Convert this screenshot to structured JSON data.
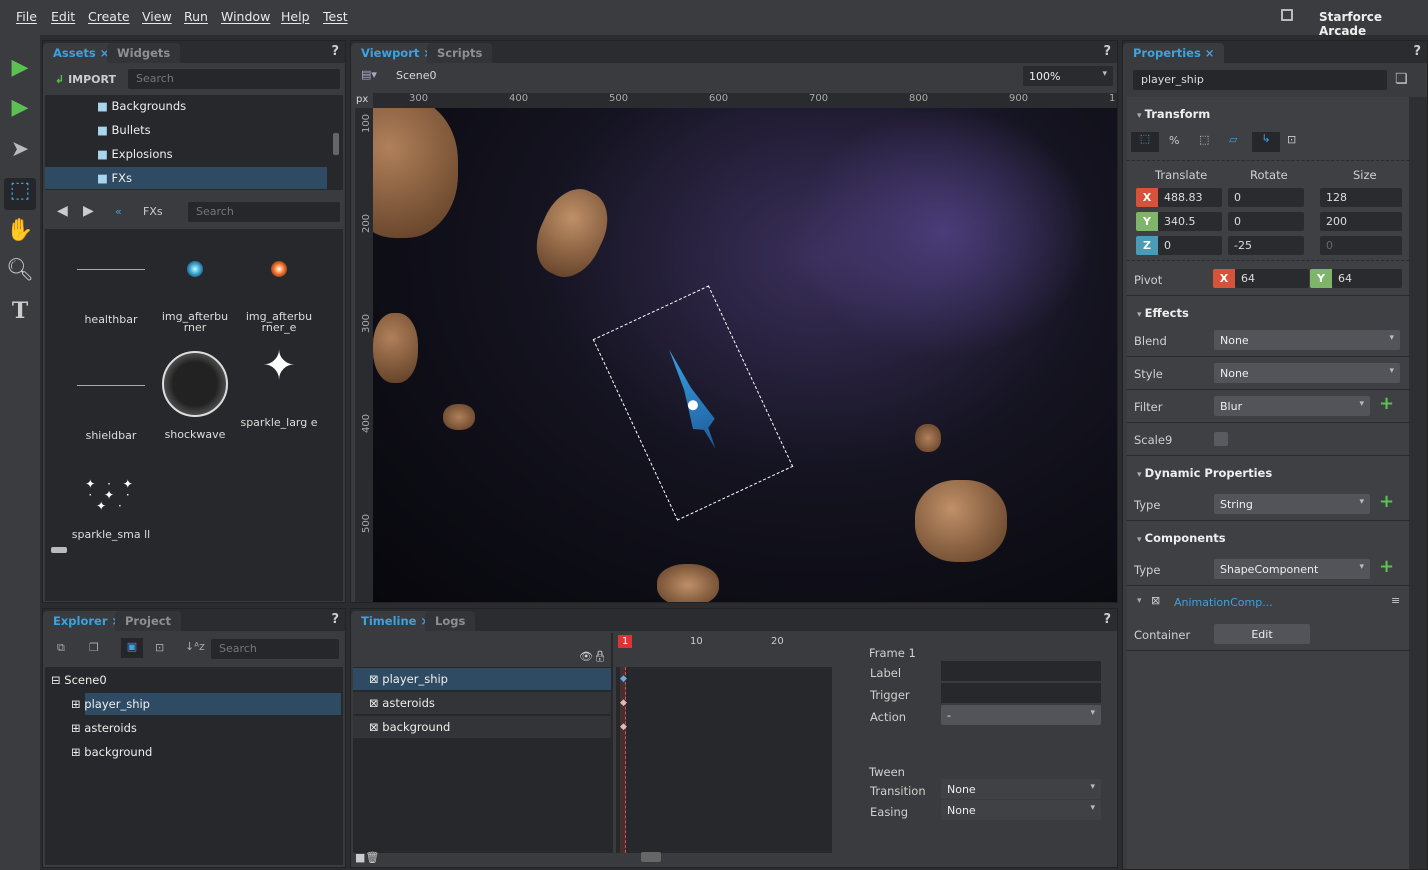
{
  "menu": [
    "File",
    "Edit",
    "Create",
    "View",
    "Run",
    "Window",
    "Help",
    "Test"
  ],
  "app_title": "Starforce Arcade",
  "assets": {
    "tabs": [
      "Assets",
      "Widgets"
    ],
    "import_label": "IMPORT",
    "search_placeholder": "Search",
    "folders": [
      "Backgrounds",
      "Bullets",
      "Explosions",
      "FXs"
    ],
    "selected_folder": "FXs",
    "breadcrumb": "FXs",
    "search2_placeholder": "Search",
    "items": [
      "healthbar",
      "img_afterbu rner",
      "img_afterbu rner_e",
      "shieldbar",
      "shockwave",
      "sparkle_larg e",
      "sparkle_sma ll"
    ]
  },
  "viewport": {
    "tabs": [
      "Viewport",
      "Scripts"
    ],
    "scene": "Scene0",
    "zoom": "100%",
    "unit": "px",
    "ruler_x": [
      "300",
      "400",
      "500",
      "600",
      "700",
      "800",
      "900",
      "1"
    ],
    "ruler_y": [
      "100",
      "200",
      "300",
      "400",
      "500"
    ]
  },
  "explorer": {
    "tabs": [
      "Explorer",
      "Project"
    ],
    "search_placeholder": "Search",
    "root": "Scene0",
    "nodes": [
      "player_ship",
      "asteroids",
      "background"
    ],
    "selected": "player_ship"
  },
  "timeline": {
    "tabs": [
      "Timeline",
      "Logs"
    ],
    "layers": [
      "player_ship",
      "asteroids",
      "background"
    ],
    "frames": [
      "1",
      "10",
      "20"
    ],
    "frame_title": "Frame 1",
    "label": "Label",
    "trigger": "Trigger",
    "action": "Action",
    "action_value": "-",
    "tween": "Tween",
    "transition": "Transition",
    "transition_value": "None",
    "easing": "Easing",
    "easing_value": "None"
  },
  "properties": {
    "tab": "Properties",
    "name": "player_ship",
    "transform": {
      "title": "Transform",
      "cols": [
        "Translate",
        "Rotate",
        "Size"
      ],
      "translate": {
        "x": "488.83",
        "y": "340.5",
        "z": "0"
      },
      "rotate": {
        "x": "0",
        "y": "0",
        "z": "-25"
      },
      "size": {
        "x": "128",
        "y": "200",
        "z": "0"
      },
      "pivot_label": "Pivot",
      "pivot": {
        "x": "64",
        "y": "64"
      },
      "axes": [
        "X",
        "Y",
        "Z"
      ]
    },
    "effects": {
      "title": "Effects",
      "blend_label": "Blend",
      "blend": "None",
      "style_label": "Style",
      "style": "None",
      "filter_label": "Filter",
      "filter": "Blur",
      "scale9_label": "Scale9",
      "scale9": false
    },
    "dynamic": {
      "title": "Dynamic Properties",
      "type_label": "Type",
      "type": "String"
    },
    "components": {
      "title": "Components",
      "type_label": "Type",
      "type": "ShapeComponent",
      "anim": "AnimationComp...",
      "container_label": "Container",
      "edit_label": "Edit"
    }
  },
  "colors": {
    "accent": "#3aa3e3",
    "x": "#d6533a",
    "y": "#7fb56a",
    "z": "#4a9bb5",
    "selection": "#2f4b63"
  }
}
